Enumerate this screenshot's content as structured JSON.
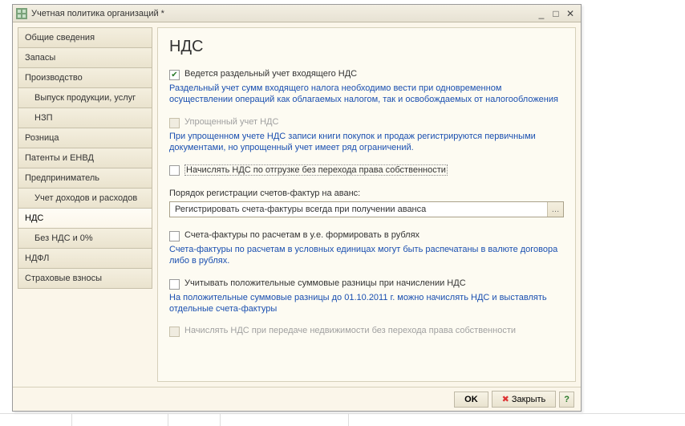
{
  "window": {
    "title": "Учетная политика организаций *",
    "minimize": "_",
    "maximize": "□",
    "close": "✕"
  },
  "sidebar": {
    "items": [
      {
        "label": "Общие сведения",
        "child": false
      },
      {
        "label": "Запасы",
        "child": false
      },
      {
        "label": "Производство",
        "child": false
      },
      {
        "label": "Выпуск продукции, услуг",
        "child": true
      },
      {
        "label": "НЗП",
        "child": true
      },
      {
        "label": "Розница",
        "child": false
      },
      {
        "label": "Патенты и ЕНВД",
        "child": false
      },
      {
        "label": "Предприниматель",
        "child": false
      },
      {
        "label": "Учет доходов и расходов",
        "child": true
      },
      {
        "label": "НДС",
        "child": false,
        "active": true
      },
      {
        "label": "Без НДС и 0%",
        "child": true
      },
      {
        "label": "НДФЛ",
        "child": false
      },
      {
        "label": "Страховые взносы",
        "child": false
      }
    ]
  },
  "content": {
    "heading": "НДС",
    "separate_accounting": {
      "label": "Ведется раздельный учет входящего НДС",
      "checked": true,
      "desc": "Раздельный учет сумм входящего налога необходимо вести при одновременном осуществлении операций как облагаемых налогом, так и освобождаемых от налогообложения"
    },
    "simplified": {
      "label": "Упрощенный учет НДС",
      "checked": false,
      "disabled": true,
      "desc": "При упрощенном учете НДС записи книги покупок и продаж регистрируются первичными документами, но упрощенный учет имеет ряд ограничений."
    },
    "on_shipment": {
      "label": "Начислять НДС по отгрузке без перехода права собственности",
      "checked": false
    },
    "advance": {
      "label": "Порядок регистрации счетов-фактур на аванс:",
      "value": "Регистрировать счета-фактуры всегда при получении аванса",
      "button": "…"
    },
    "invoices_rub": {
      "label": "Счета-фактуры по расчетам в у.е. формировать в рублях",
      "checked": false,
      "desc": "Счета-фактуры по расчетам в условных единицах могут быть распечатаны в валюте договора либо в рублях."
    },
    "positive_diff": {
      "label": "Учитывать положительные суммовые разницы при начислении НДС",
      "checked": false,
      "desc": "На положительные суммовые разницы до 01.10.2011 г. можно начислять НДС и выставлять отдельные счета-фактуры"
    },
    "realty": {
      "label": "Начислять НДС при передаче недвижимости без перехода права собственности",
      "checked": false,
      "disabled": true
    }
  },
  "footer": {
    "ok": "OK",
    "close": "Закрыть",
    "help": "?"
  }
}
